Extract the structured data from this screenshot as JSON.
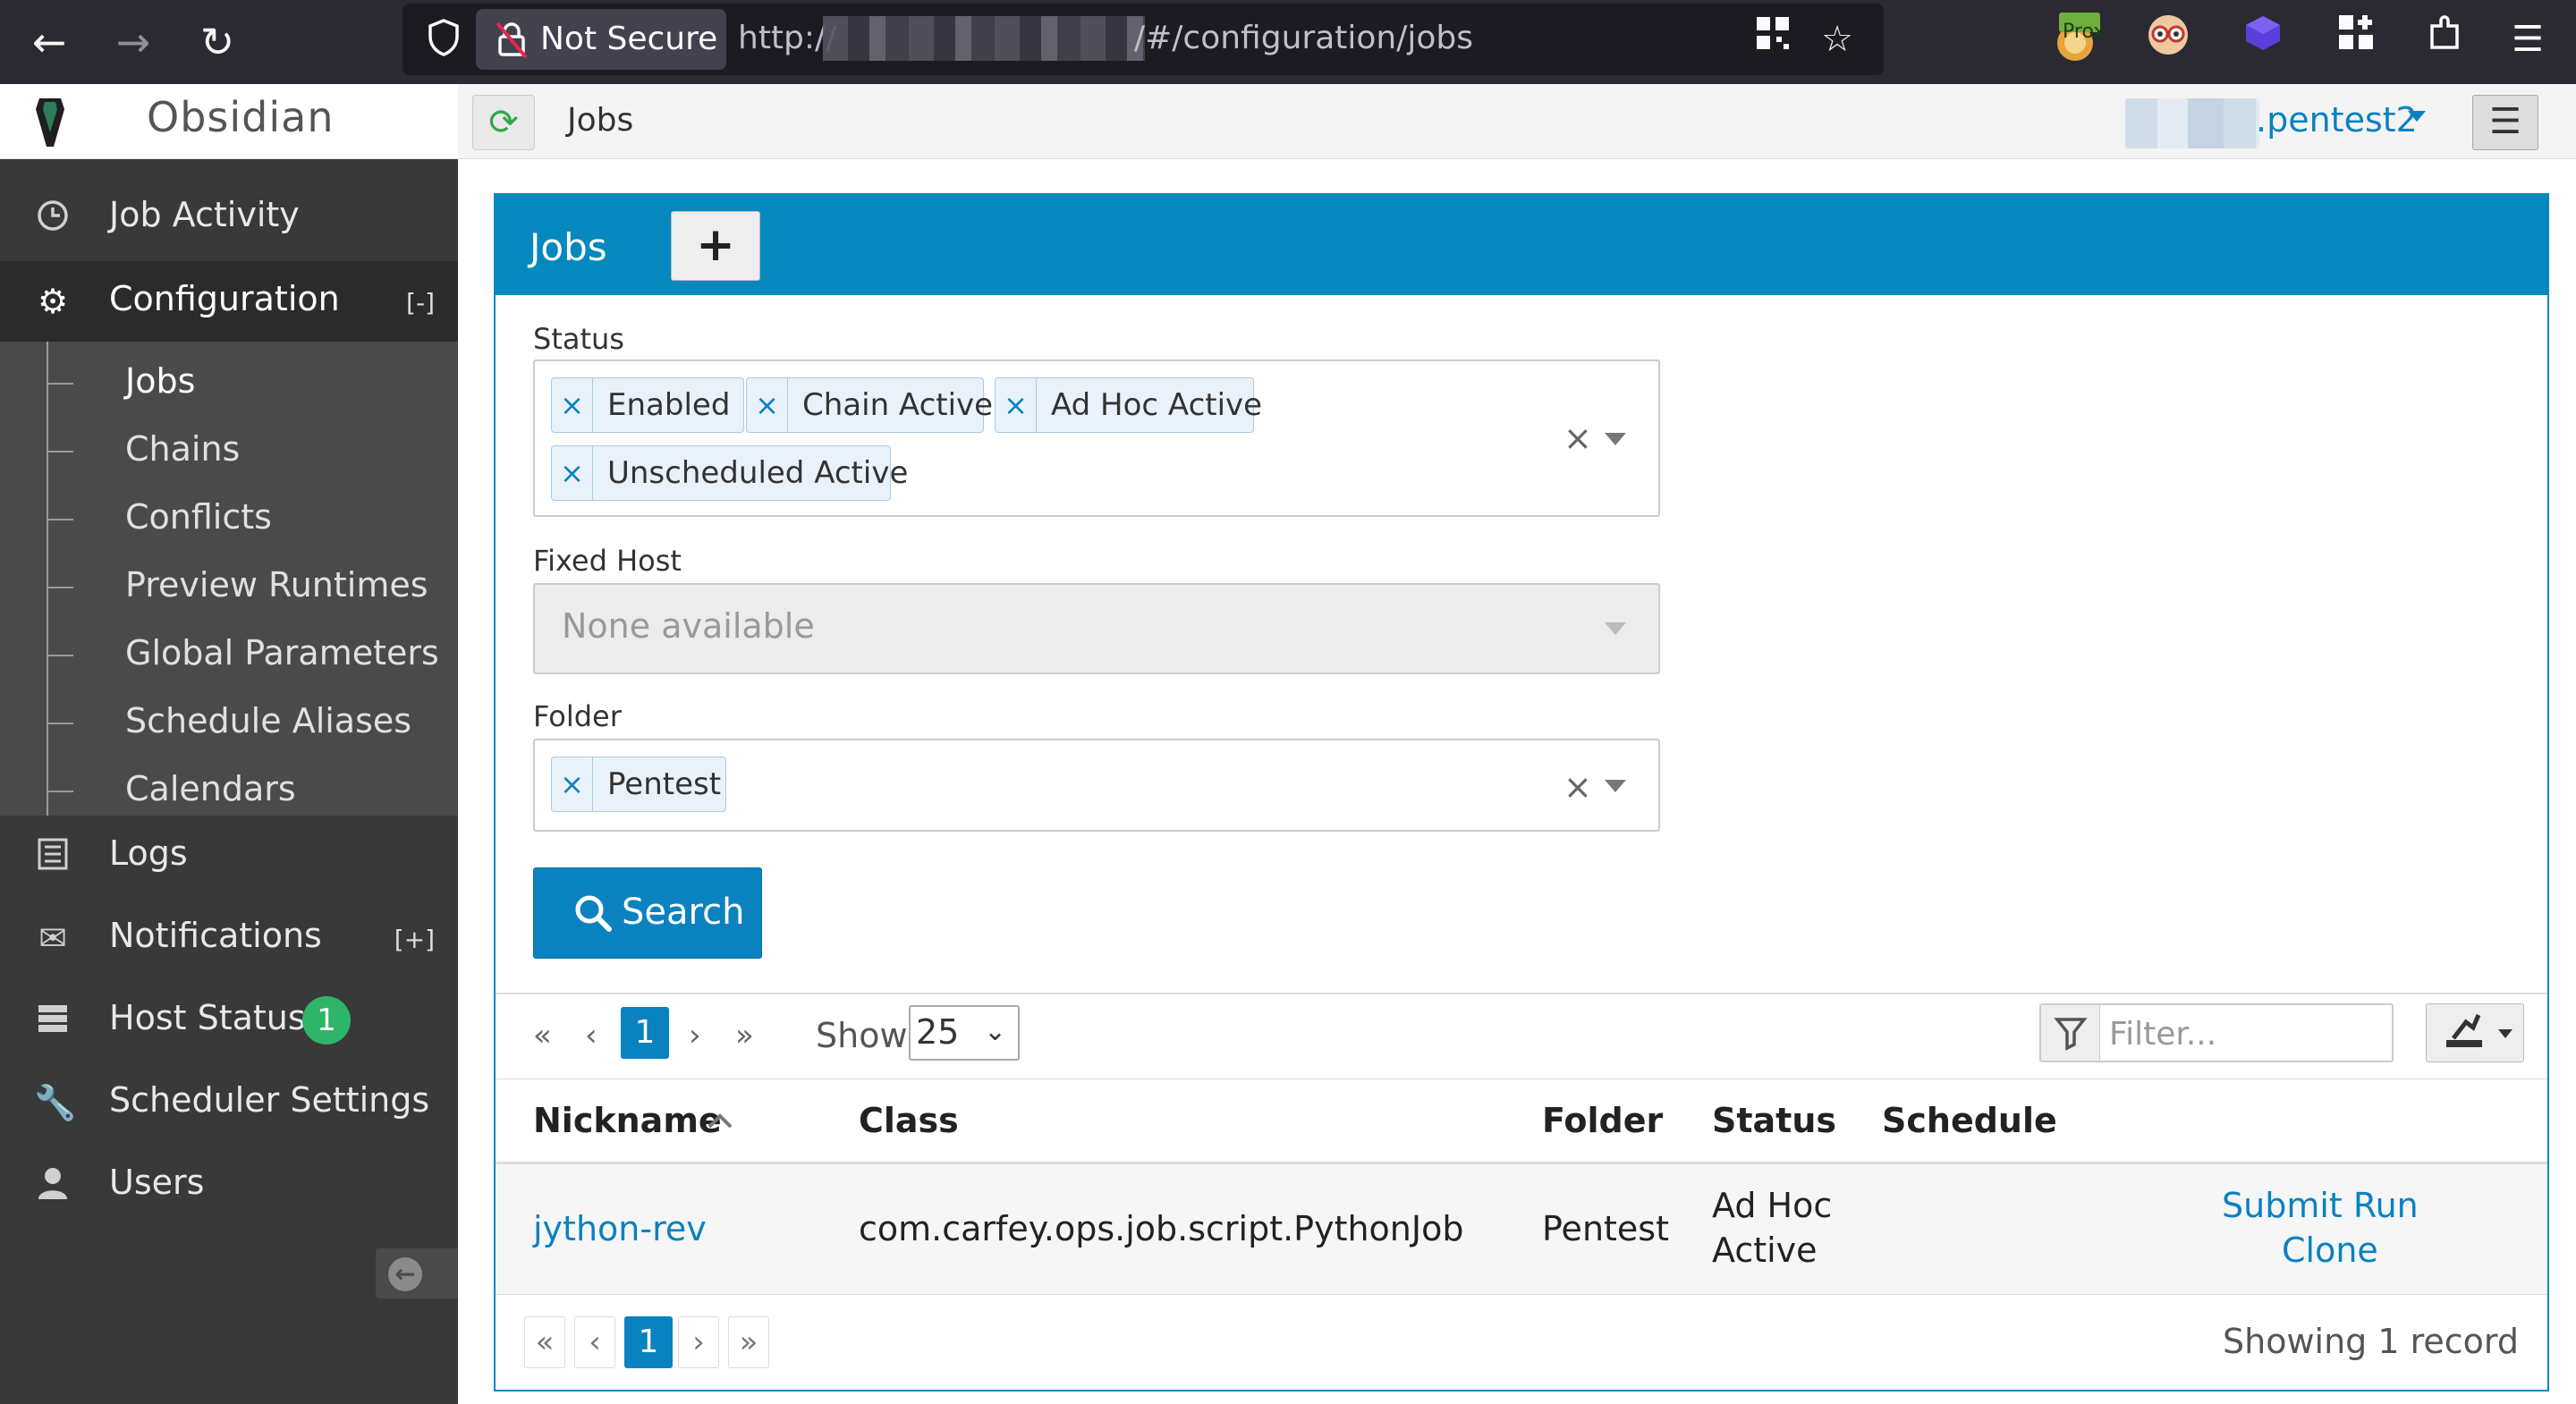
{
  "browser": {
    "security_label": "Not Secure",
    "url_prefix": "http://",
    "url_suffix": "/#/configuration/jobs",
    "prox_badge": "Prox"
  },
  "app": {
    "name": "Obsidian",
    "breadcrumb": "Jobs",
    "user_suffix": ".pentest2"
  },
  "sidebar": {
    "items": [
      {
        "label": "Job Activity",
        "icon": "clock-icon"
      },
      {
        "label": "Configuration",
        "icon": "gear-icon",
        "toggle": "[-]"
      },
      {
        "label": "Logs",
        "icon": "list-icon"
      },
      {
        "label": "Notifications",
        "icon": "envelope-icon",
        "toggle": "[+]"
      },
      {
        "label": "Host Status",
        "icon": "server-icon",
        "badge": "1"
      },
      {
        "label": "Scheduler Settings",
        "icon": "wrench-icon"
      },
      {
        "label": "Users",
        "icon": "user-icon"
      }
    ],
    "config_sub": [
      "Jobs",
      "Chains",
      "Conflicts",
      "Preview Runtimes",
      "Global Parameters",
      "Schedule Aliases",
      "Calendars"
    ]
  },
  "panel": {
    "title": "Jobs",
    "add_symbol": "+",
    "status_label": "Status",
    "status_chips": [
      "Enabled",
      "Chain Active",
      "Ad Hoc Active",
      "Unscheduled Active"
    ],
    "fixed_host_label": "Fixed Host",
    "fixed_host_placeholder": "None available",
    "folder_label": "Folder",
    "folder_chips": [
      "Pentest"
    ],
    "search_label": "Search",
    "chip_remove": "×",
    "clear": "×"
  },
  "pager": {
    "first": "«",
    "prev": "‹",
    "current": "1",
    "next": "›",
    "last": "»",
    "show_label": "Show",
    "page_size": "25",
    "filter_placeholder": "Filter..."
  },
  "table": {
    "columns": [
      "Nickname",
      "Class",
      "Folder",
      "Status",
      "Schedule"
    ],
    "rows": [
      {
        "nickname": "jython-rev",
        "class": "com.carfey.ops.job.script.PythonJob",
        "folder": "Pentest",
        "status_line1": "Ad Hoc",
        "status_line2": "Active",
        "schedule": "",
        "action1": "Submit Run",
        "action2": "Clone"
      }
    ],
    "footer_text": "Showing 1 record"
  },
  "colors": {
    "accent": "#0588bd",
    "link": "#0a82c0",
    "sidebar_bg": "#393939",
    "badge": "#2fb568"
  }
}
